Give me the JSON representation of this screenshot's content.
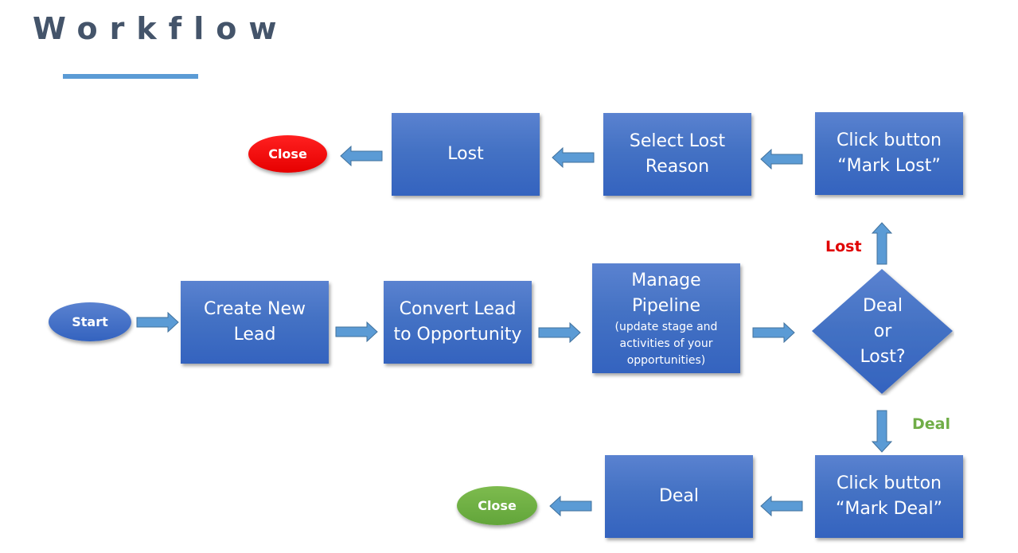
{
  "header": {
    "title": "Workflow"
  },
  "colors": {
    "box_fill": "#4472c4",
    "arrow_fill": "#5b9bd5",
    "title_text": "#44546a",
    "accent_bar": "#5b9bd5",
    "close_lost": "#ff0000",
    "close_deal": "#70ad47",
    "label_lost": "#e00000",
    "label_deal": "#70ad47"
  },
  "nodes": {
    "start": {
      "label": "Start",
      "shape": "oval"
    },
    "create_lead": {
      "label_line1": "Create New",
      "label_line2": "Lead"
    },
    "convert_lead": {
      "label_line1": "Convert Lead",
      "label_line2": "to Opportunity"
    },
    "manage_pipeline": {
      "label_line1": "Manage",
      "label_line2": "Pipeline",
      "sub_line1": "(update stage and",
      "sub_line2": "activities of your",
      "sub_line3": "opportunities)"
    },
    "decision": {
      "line1": "Deal",
      "line2": "or",
      "line3": "Lost?"
    },
    "mark_lost": {
      "label_line1": "Click button",
      "label_line2": "“Mark Lost”"
    },
    "select_lost_reason": {
      "label_line1": "Select Lost",
      "label_line2": "Reason"
    },
    "lost": {
      "label": "Lost"
    },
    "close_lost": {
      "label": "Close"
    },
    "mark_deal": {
      "label_line1": "Click button",
      "label_line2": "“Mark Deal”"
    },
    "deal": {
      "label": "Deal"
    },
    "close_deal": {
      "label": "Close"
    }
  },
  "branch_labels": {
    "lost": "Lost",
    "deal": "Deal"
  },
  "edges": [
    {
      "from": "start",
      "to": "create_lead",
      "direction": "right"
    },
    {
      "from": "create_lead",
      "to": "convert_lead",
      "direction": "right"
    },
    {
      "from": "convert_lead",
      "to": "manage_pipeline",
      "direction": "right"
    },
    {
      "from": "manage_pipeline",
      "to": "decision",
      "direction": "right"
    },
    {
      "from": "decision",
      "to": "mark_lost",
      "direction": "up",
      "label": "Lost"
    },
    {
      "from": "mark_lost",
      "to": "select_lost_reason",
      "direction": "left"
    },
    {
      "from": "select_lost_reason",
      "to": "lost",
      "direction": "left"
    },
    {
      "from": "lost",
      "to": "close_lost",
      "direction": "left"
    },
    {
      "from": "decision",
      "to": "mark_deal",
      "direction": "down",
      "label": "Deal"
    },
    {
      "from": "mark_deal",
      "to": "deal",
      "direction": "left"
    },
    {
      "from": "deal",
      "to": "close_deal",
      "direction": "left"
    }
  ]
}
